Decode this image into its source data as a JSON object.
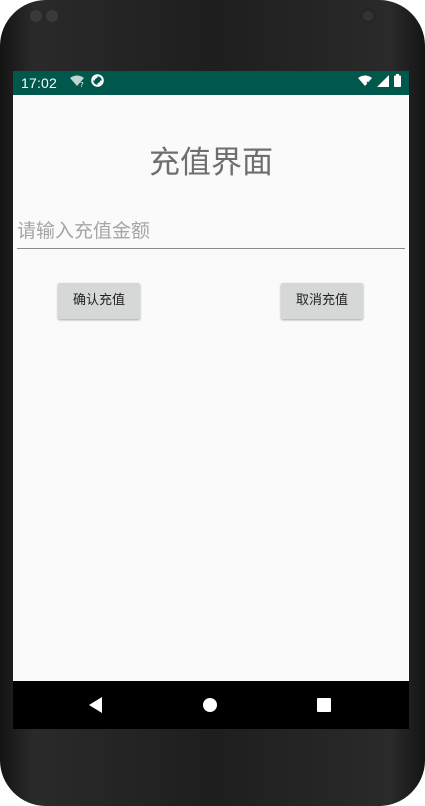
{
  "status_bar": {
    "time": "17:02",
    "left_icons": [
      "wifi-question-icon",
      "do-not-disturb-icon"
    ],
    "right_icons": [
      "wifi-x-icon",
      "signal-icon",
      "battery-icon"
    ],
    "color": "#00574b"
  },
  "page": {
    "title": "充值界面",
    "amount_input": {
      "value": "",
      "placeholder": "请输入充值金额"
    },
    "buttons": {
      "confirm_label": "确认充值",
      "cancel_label": "取消充值"
    }
  },
  "nav_bar": {
    "icons": [
      "back-icon",
      "home-icon",
      "recents-icon"
    ]
  }
}
